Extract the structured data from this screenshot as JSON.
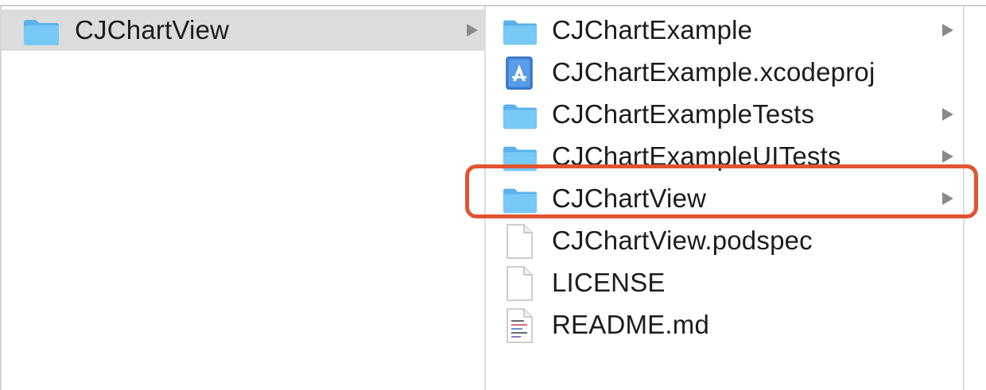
{
  "column1": {
    "items": [
      {
        "label": "CJChartView",
        "icon": "folder-icon",
        "has_children": true,
        "selected": true
      }
    ]
  },
  "column2": {
    "items": [
      {
        "label": "CJChartExample",
        "icon": "folder-icon",
        "has_children": true
      },
      {
        "label": "CJChartExample.xcodeproj",
        "icon": "xcode-project-icon",
        "has_children": false
      },
      {
        "label": "CJChartExampleTests",
        "icon": "folder-icon",
        "has_children": true
      },
      {
        "label": "CJChartExampleUITests",
        "icon": "folder-icon",
        "has_children": true
      },
      {
        "label": "CJChartView",
        "icon": "folder-icon",
        "has_children": true,
        "highlighted": true
      },
      {
        "label": "CJChartView.podspec",
        "icon": "document-icon",
        "has_children": false
      },
      {
        "label": "LICENSE",
        "icon": "document-icon",
        "has_children": false
      },
      {
        "label": "README.md",
        "icon": "text-document-icon",
        "has_children": false
      }
    ]
  },
  "colors": {
    "folder": "#6cc0f2",
    "selection": "#dcdcdc",
    "highlight": "#e05530",
    "arrow": "#8a8a8a"
  }
}
